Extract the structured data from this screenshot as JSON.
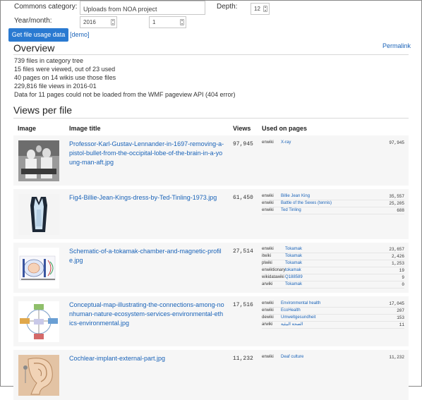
{
  "form": {
    "category_label": "Commons category:",
    "category_value": "Uploads from NOA project",
    "depth_label": "Depth:",
    "depth_value": "12",
    "yearmonth_label": "Year/month:",
    "year_value": "2016",
    "month_value": "1",
    "submit_label": "Get file usage data",
    "demo_label": "[demo]"
  },
  "overview": {
    "heading": "Overview",
    "permalink": "Permalink",
    "lines": [
      "739 files in category tree",
      "15 files were viewed, out of 23 used",
      "40 pages on 14 wikis use those files",
      "229,816 file views in 2016-01",
      "Data for 11 pages could not be loaded from the WMF pageview API (404 error)"
    ]
  },
  "views_per_file": {
    "heading": "Views per file",
    "columns": [
      "Image",
      "Image title",
      "Views",
      "Used on pages"
    ],
    "files": [
      {
        "title": "Professor-Karl-Gustav-Lennander-in-1697-removing-a-pistol-bullet-from-the-occipital-lobe-of-the-brain-in-a-young-man-aft.jpg",
        "views": "97,945",
        "thumb_icon": "surgery-photo-icon",
        "usage": [
          {
            "wiki": "enwiki",
            "page": "X-ray",
            "views": "97,945"
          }
        ]
      },
      {
        "title": "Fig4-Billie-Jean-Kings-dress-by-Ted-Tinling-1973.jpg",
        "views": "61,450",
        "thumb_icon": "dress-photo-icon",
        "usage": [
          {
            "wiki": "enwiki",
            "page": "Billie Jean King",
            "views": "35,557"
          },
          {
            "wiki": "enwiki",
            "page": "Battle of the Sexes (tennis)",
            "views": "25,205"
          },
          {
            "wiki": "enwiki",
            "page": "Ted Tinling",
            "views": "688"
          }
        ]
      },
      {
        "title": "Schematic-of-a-tokamak-chamber-and-magnetic-profile.jpg",
        "views": "27,514",
        "thumb_icon": "tokamak-diagram-icon",
        "usage": [
          {
            "wiki": "enwiki",
            "page": "Tokamak",
            "views": "23,657"
          },
          {
            "wiki": "itwiki",
            "page": "Tokamak",
            "views": "2,426"
          },
          {
            "wiki": "plwiki",
            "page": "Tokamak",
            "views": "1,253"
          },
          {
            "wiki": "enwiktionary",
            "page": "tokamak",
            "views": "19"
          },
          {
            "wiki": "wikidatawiki",
            "page": "Q188589",
            "views": "9"
          },
          {
            "wiki": "arwiki",
            "page": "Tokamak",
            "views": "0"
          }
        ]
      },
      {
        "title": "Conceptual-map-illustrating-the-connections-among-nonhuman-nature-ecosystem-services-environmental-ethics-environmental.jpg",
        "views": "17,516",
        "thumb_icon": "concept-map-icon",
        "usage": [
          {
            "wiki": "enwiki",
            "page": "Environmental health",
            "views": "17,045"
          },
          {
            "wiki": "enwiki",
            "page": "EcoHealth",
            "views": "207"
          },
          {
            "wiki": "dewiki",
            "page": "Umweltgesundheit",
            "views": "153"
          },
          {
            "wiki": "arwiki",
            "page": "الصحة البيئية",
            "views": "11"
          }
        ]
      },
      {
        "title": "Cochlear-implant-external-part.jpg",
        "views": "11,232",
        "thumb_icon": "ear-photo-icon",
        "usage": [
          {
            "wiki": "enwiki",
            "page": "Deaf culture",
            "views": "11,232"
          }
        ]
      }
    ]
  }
}
